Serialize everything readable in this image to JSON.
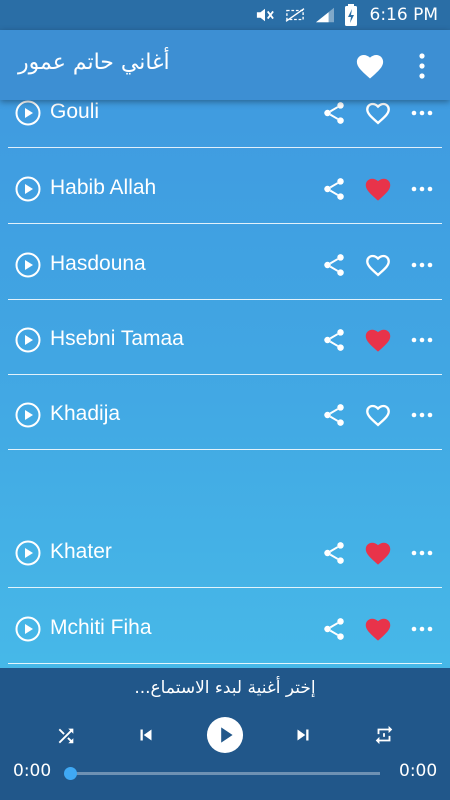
{
  "status_bar": {
    "time": "6:16 PM",
    "icons": [
      "mute-icon",
      "no-sim-icon",
      "signal-icon",
      "battery-charging-icon"
    ]
  },
  "app_bar": {
    "title": "أغاني حاتم عمور",
    "favorites_icon": "heart-icon",
    "menu_icon": "more-vertical-icon"
  },
  "songs": [
    {
      "name": "Gouli",
      "favorite": false
    },
    {
      "name": "Habib Allah",
      "favorite": true
    },
    {
      "name": "Hasdouna",
      "favorite": false
    },
    {
      "name": "Hsebni Tamaa",
      "favorite": true
    },
    {
      "name": "Khadija",
      "favorite": false
    },
    {
      "name": "Khater",
      "favorite": true
    },
    {
      "name": "Mchiti Fiha",
      "favorite": true
    }
  ],
  "player": {
    "status_text": "إختر أغنية لبدء الاستماع...",
    "current_time": "0:00",
    "total_time": "0:00",
    "progress": 0
  },
  "colors": {
    "heart_filled": "#e8334a",
    "app_bar": "#3d8fd3",
    "player_bg": "#21578a",
    "seek_thumb": "#3fa9f5"
  }
}
